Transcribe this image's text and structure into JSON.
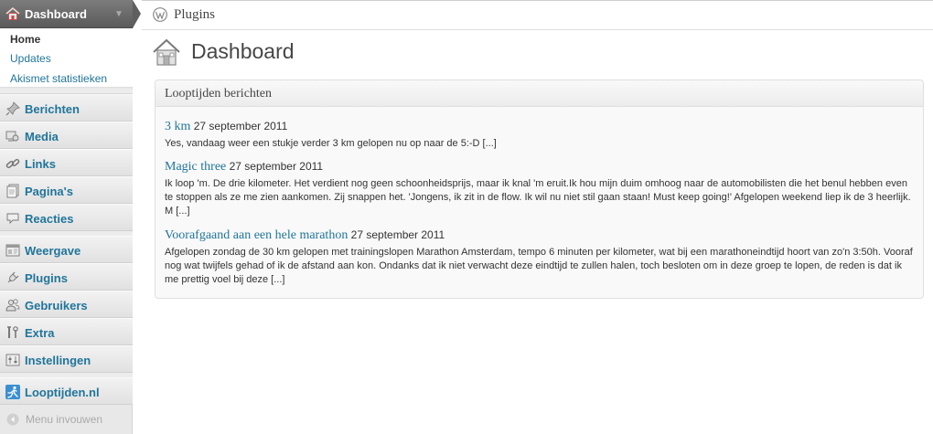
{
  "sidebar": {
    "dashboard": {
      "label": "Dashboard",
      "icon": "home-icon"
    },
    "submenu": [
      {
        "label": "Home",
        "current": true
      },
      {
        "label": "Updates",
        "current": false
      },
      {
        "label": "Akismet statistieken",
        "current": false
      }
    ],
    "items": [
      {
        "label": "Berichten",
        "icon": "pushpin-icon"
      },
      {
        "label": "Media",
        "icon": "media-icon"
      },
      {
        "label": "Links",
        "icon": "link-icon"
      },
      {
        "label": "Pagina's",
        "icon": "pages-icon"
      },
      {
        "label": "Reacties",
        "icon": "comments-icon"
      },
      {
        "label": "Weergave",
        "icon": "appearance-icon"
      },
      {
        "label": "Plugins",
        "icon": "plugins-icon"
      },
      {
        "label": "Gebruikers",
        "icon": "users-icon"
      },
      {
        "label": "Extra",
        "icon": "tools-icon"
      },
      {
        "label": "Instellingen",
        "icon": "settings-icon"
      },
      {
        "label": "Looptijden.nl",
        "icon": "runner-icon"
      }
    ],
    "collapse_label": "Menu invouwen"
  },
  "topbar": {
    "title": "Plugins"
  },
  "page": {
    "title": "Dashboard"
  },
  "widget": {
    "title": "Looptijden berichten",
    "posts": [
      {
        "title": "3 km",
        "date": "27 september 2011",
        "excerpt": "Yes, vandaag weer een stukje verder 3 km gelopen nu op naar de 5:-D [...]"
      },
      {
        "title": "Magic three",
        "date": "27 september 2011",
        "excerpt": "Ik loop 'm. De drie kilometer. Het verdient nog geen schoonheidsprijs, maar ik knal 'm eruit.Ik hou mijn duim omhoog naar de automobilisten die het benul hebben even te stoppen als ze me zien aankomen. Zij snappen het. 'Jongens, ik zit in de flow. Ik wil nu niet stil gaan staan! Must keep going!' Afgelopen weekend liep ik de 3 heerlijk. M [...]"
      },
      {
        "title": "Voorafgaand aan een hele marathon",
        "date": "27 september 2011",
        "excerpt": "Afgelopen zondag de 30 km gelopen met trainingslopen Marathon Amsterdam, tempo 6 minuten per kilometer, wat bij een marathoneindtijd hoort van zo'n 3:50h. Vooraf nog wat twijfels gehad of ik de afstand aan kon. Ondanks dat ik niet verwacht deze eindtijd te zullen halen, toch besloten om in deze groep te lopen, de reden is dat ik me prettig voel bij deze [...]"
      }
    ]
  },
  "colors": {
    "link": "#21759b",
    "sidebar_bg": "#e8e8e8",
    "dashboard_head": "#5f5f5f",
    "heading_text": "#464646"
  }
}
